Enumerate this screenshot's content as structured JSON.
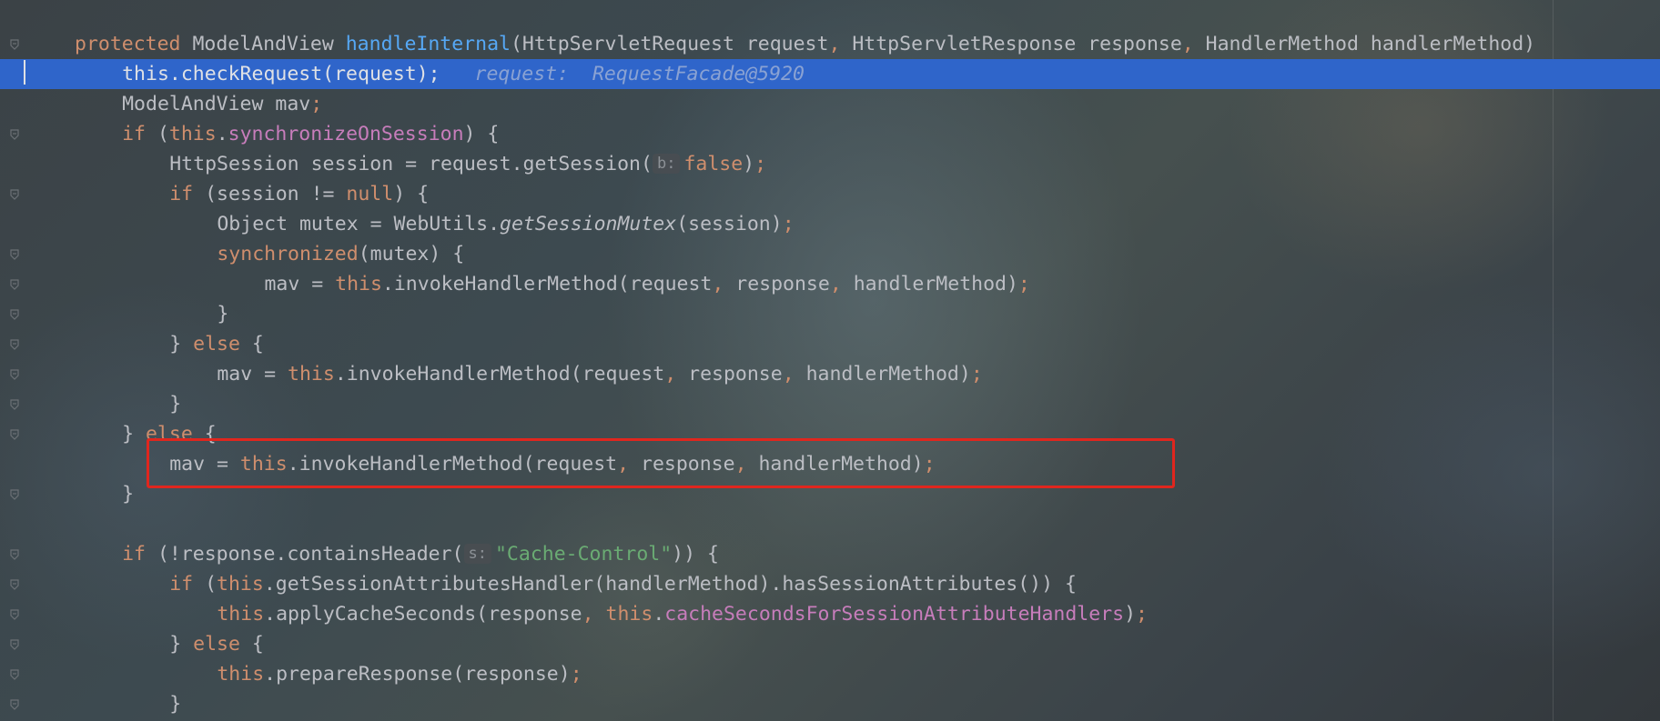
{
  "editor": {
    "language": "java",
    "highlight_color": "#e0261e",
    "execution_line_color": "#2f65ca",
    "lines": [
      {
        "tokens": [
          {
            "t": "protected ",
            "c": "kw"
          },
          {
            "t": "ModelAndView ",
            "c": ""
          },
          {
            "t": "handleInternal",
            "c": "fn"
          },
          {
            "t": "(HttpServletRequest request",
            "c": ""
          },
          {
            "t": ", ",
            "c": "kw"
          },
          {
            "t": "HttpServletResponse response",
            "c": ""
          },
          {
            "t": ", ",
            "c": "kw"
          },
          {
            "t": "HandlerMethod handlerMethod)",
            "c": ""
          }
        ]
      },
      {
        "tokens": [
          {
            "t": "this",
            "c": "kw"
          },
          {
            "t": ".checkRequest(request)",
            "c": ""
          },
          {
            "t": ";",
            "c": "kw"
          }
        ],
        "debug_value": "request:  RequestFacade@5920"
      },
      {
        "tokens": [
          {
            "t": "ModelAndView mav",
            "c": ""
          },
          {
            "t": ";",
            "c": "kw"
          }
        ]
      },
      {
        "tokens": [
          {
            "t": "if ",
            "c": "kw"
          },
          {
            "t": "(",
            "c": ""
          },
          {
            "t": "this",
            "c": "kw"
          },
          {
            "t": ".",
            "c": ""
          },
          {
            "t": "synchronizeOnSession",
            "c": "field"
          },
          {
            "t": ") {",
            "c": ""
          }
        ]
      },
      {
        "tokens": [
          {
            "t": "HttpSession session = request.getSession(",
            "c": ""
          },
          {
            "t": "b:",
            "c": "hint"
          },
          {
            "t": "false",
            "c": "kw"
          },
          {
            "t": ")",
            "c": ""
          },
          {
            "t": ";",
            "c": "kw"
          }
        ]
      },
      {
        "tokens": [
          {
            "t": "if ",
            "c": "kw"
          },
          {
            "t": "(session != ",
            "c": ""
          },
          {
            "t": "null",
            "c": "kw"
          },
          {
            "t": ") {",
            "c": ""
          }
        ]
      },
      {
        "tokens": [
          {
            "t": "Object mutex = WebUtils.",
            "c": ""
          },
          {
            "t": "getSessionMutex",
            "c": "italic"
          },
          {
            "t": "(session)",
            "c": ""
          },
          {
            "t": ";",
            "c": "kw"
          }
        ]
      },
      {
        "tokens": [
          {
            "t": "synchronized",
            "c": "kw"
          },
          {
            "t": "(mutex) {",
            "c": ""
          }
        ]
      },
      {
        "tokens": [
          {
            "t": "mav = ",
            "c": ""
          },
          {
            "t": "this",
            "c": "kw"
          },
          {
            "t": ".invokeHandlerMethod(request",
            "c": ""
          },
          {
            "t": ", ",
            "c": "kw"
          },
          {
            "t": "response",
            "c": ""
          },
          {
            "t": ", ",
            "c": "kw"
          },
          {
            "t": "handlerMethod)",
            "c": ""
          },
          {
            "t": ";",
            "c": "kw"
          }
        ]
      },
      {
        "tokens": [
          {
            "t": "}",
            "c": ""
          }
        ]
      },
      {
        "tokens": [
          {
            "t": "} ",
            "c": ""
          },
          {
            "t": "else ",
            "c": "kw"
          },
          {
            "t": "{",
            "c": ""
          }
        ]
      },
      {
        "tokens": [
          {
            "t": "mav = ",
            "c": ""
          },
          {
            "t": "this",
            "c": "kw"
          },
          {
            "t": ".invokeHandlerMethod(request",
            "c": ""
          },
          {
            "t": ", ",
            "c": "kw"
          },
          {
            "t": "response",
            "c": ""
          },
          {
            "t": ", ",
            "c": "kw"
          },
          {
            "t": "handlerMethod)",
            "c": ""
          },
          {
            "t": ";",
            "c": "kw"
          }
        ]
      },
      {
        "tokens": [
          {
            "t": "}",
            "c": ""
          }
        ]
      },
      {
        "tokens": [
          {
            "t": "} ",
            "c": ""
          },
          {
            "t": "else ",
            "c": "kw"
          },
          {
            "t": "{",
            "c": ""
          }
        ]
      },
      {
        "tokens": [
          {
            "t": "mav = ",
            "c": ""
          },
          {
            "t": "this",
            "c": "kw"
          },
          {
            "t": ".invokeHandlerMethod(request",
            "c": ""
          },
          {
            "t": ", ",
            "c": "kw"
          },
          {
            "t": "response",
            "c": ""
          },
          {
            "t": ", ",
            "c": "kw"
          },
          {
            "t": "handlerMethod)",
            "c": ""
          },
          {
            "t": ";",
            "c": "kw"
          }
        ]
      },
      {
        "tokens": [
          {
            "t": "}",
            "c": ""
          }
        ]
      },
      {
        "tokens": []
      },
      {
        "tokens": [
          {
            "t": "if ",
            "c": "kw"
          },
          {
            "t": "(!response.containsHeader(",
            "c": ""
          },
          {
            "t": "s:",
            "c": "hint"
          },
          {
            "t": "\"Cache-Control\"",
            "c": "str"
          },
          {
            "t": ")) {",
            "c": ""
          }
        ]
      },
      {
        "tokens": [
          {
            "t": "if ",
            "c": "kw"
          },
          {
            "t": "(",
            "c": ""
          },
          {
            "t": "this",
            "c": "kw"
          },
          {
            "t": ".getSessionAttributesHandler(handlerMethod).hasSessionAttributes()) {",
            "c": ""
          }
        ]
      },
      {
        "tokens": [
          {
            "t": "this",
            "c": "kw"
          },
          {
            "t": ".applyCacheSeconds(response",
            "c": ""
          },
          {
            "t": ", ",
            "c": "kw"
          },
          {
            "t": "this",
            "c": "kw"
          },
          {
            "t": ".",
            "c": ""
          },
          {
            "t": "cacheSecondsForSessionAttributeHandlers",
            "c": "field"
          },
          {
            "t": ")",
            "c": ""
          },
          {
            "t": ";",
            "c": "kw"
          }
        ]
      },
      {
        "tokens": [
          {
            "t": "} ",
            "c": ""
          },
          {
            "t": "else ",
            "c": "kw"
          },
          {
            "t": "{",
            "c": ""
          }
        ]
      },
      {
        "tokens": [
          {
            "t": "this",
            "c": "kw"
          },
          {
            "t": ".prepareResponse(response)",
            "c": ""
          },
          {
            "t": ";",
            "c": "kw"
          }
        ]
      },
      {
        "tokens": [
          {
            "t": "}",
            "c": ""
          }
        ]
      }
    ]
  }
}
